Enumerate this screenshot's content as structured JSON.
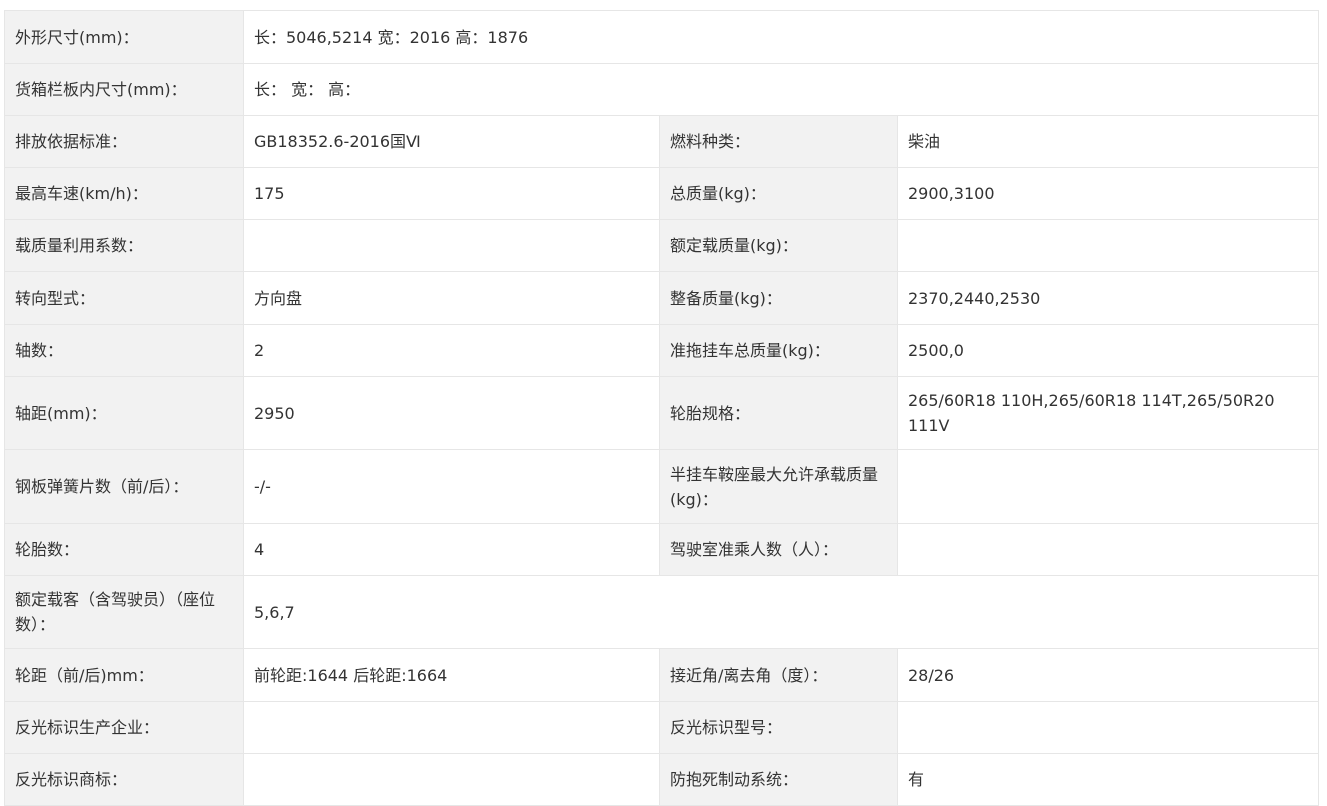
{
  "rows": [
    {
      "cells": [
        {
          "label": "外形尺寸(mm)：",
          "value": "长：5046,5214 宽：2016 高：1876",
          "span": 3
        }
      ]
    },
    {
      "cells": [
        {
          "label": "货箱栏板内尺寸(mm)：",
          "value": "长： 宽： 高：",
          "span": 3
        }
      ]
    },
    {
      "cells": [
        {
          "label": "排放依据标准：",
          "value": "GB18352.6-2016国Ⅵ"
        },
        {
          "label": "燃料种类：",
          "value": "柴油"
        }
      ]
    },
    {
      "cells": [
        {
          "label": "最高车速(km/h)：",
          "value": "175"
        },
        {
          "label": "总质量(kg)：",
          "value": "2900,3100"
        }
      ]
    },
    {
      "cells": [
        {
          "label": "载质量利用系数：",
          "value": ""
        },
        {
          "label": "额定载质量(kg)：",
          "value": ""
        }
      ]
    },
    {
      "cells": [
        {
          "label": "转向型式：",
          "value": "方向盘"
        },
        {
          "label": "整备质量(kg)：",
          "value": "2370,2440,2530"
        }
      ]
    },
    {
      "cells": [
        {
          "label": "轴数：",
          "value": "2"
        },
        {
          "label": "准拖挂车总质量(kg)：",
          "value": "2500,0"
        }
      ]
    },
    {
      "cells": [
        {
          "label": "轴距(mm)：",
          "value": "2950"
        },
        {
          "label": "轮胎规格：",
          "value": "265/60R18 110H,265/60R18 114T,265/50R20 111V"
        }
      ]
    },
    {
      "cells": [
        {
          "label": "钢板弹簧片数（前/后）：",
          "value": "-/-"
        },
        {
          "label": "半挂车鞍座最大允许承载质量(kg)：",
          "value": ""
        }
      ]
    },
    {
      "cells": [
        {
          "label": "轮胎数：",
          "value": "4"
        },
        {
          "label": "驾驶室准乘人数（人）：",
          "value": ""
        }
      ]
    },
    {
      "cells": [
        {
          "label": "额定载客（含驾驶员）（座位数）：",
          "value": "5,6,7",
          "span": 3
        }
      ]
    },
    {
      "cells": [
        {
          "label": "轮距（前/后)mm：",
          "value": "前轮距:1644 后轮距:1664"
        },
        {
          "label": "接近角/离去角（度）：",
          "value": "28/26"
        }
      ]
    },
    {
      "cells": [
        {
          "label": "反光标识生产企业：",
          "value": ""
        },
        {
          "label": "反光标识型号：",
          "value": ""
        }
      ]
    },
    {
      "cells": [
        {
          "label": "反光标识商标：",
          "value": ""
        },
        {
          "label": "防抱死制动系统：",
          "value": "有"
        }
      ]
    }
  ]
}
